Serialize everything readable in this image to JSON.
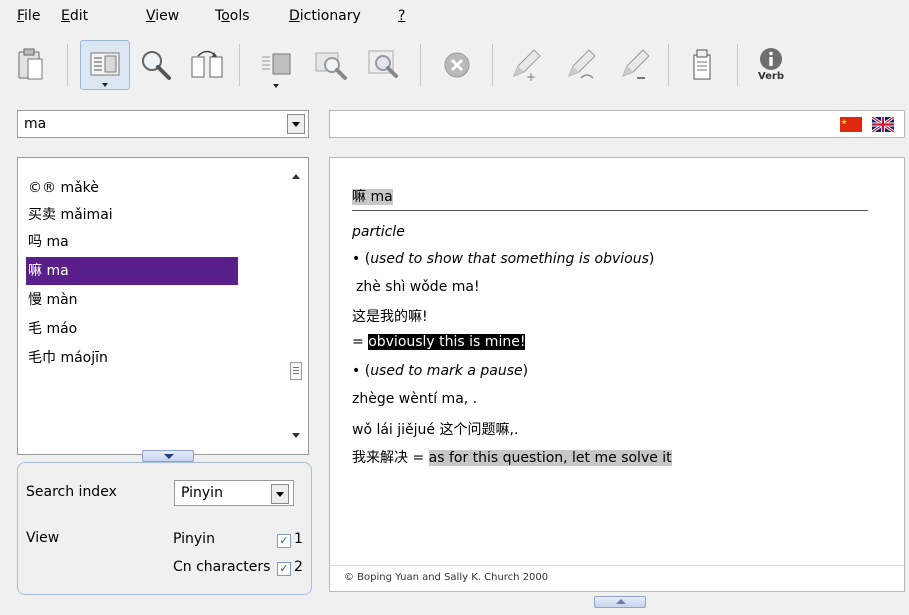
{
  "menu": {
    "file": {
      "accel": "F",
      "rest": "ile"
    },
    "edit": {
      "accel": "E",
      "rest": "dit"
    },
    "view": {
      "accel": "V",
      "rest": "iew"
    },
    "tools": {
      "pre": "T",
      "accel": "o",
      "rest": "ols"
    },
    "dictionary": {
      "accel": "D",
      "rest": "ictionary"
    },
    "help": {
      "accel": "?"
    }
  },
  "toolbar": {
    "icons": [
      "clipboard-icon",
      "dictionary-view-icon",
      "magnifier-icon",
      "flip-cards-icon",
      "list-view-icon",
      "search-next-icon",
      "search-page-icon",
      "cancel-icon",
      "pencil-add-icon",
      "pencil-edit-icon",
      "pencil-remove-icon",
      "document-icon",
      "verb-info-icon"
    ],
    "verb_label": "Verb"
  },
  "search": {
    "value": "ma"
  },
  "translation": {
    "value": "",
    "flags": [
      "china-flag-icon",
      "uk-flag-icon"
    ]
  },
  "results": {
    "items": [
      {
        "label": "©® mǎkè",
        "selected": false
      },
      {
        "label": "买卖 mǎimai",
        "selected": false
      },
      {
        "label": "吗 ma",
        "selected": false
      },
      {
        "label": "嘛 ma",
        "selected": true
      },
      {
        "label": "慢 màn",
        "selected": false
      },
      {
        "label": "毛 máo",
        "selected": false
      },
      {
        "label": "毛巾 máojīn",
        "selected": false
      }
    ]
  },
  "options": {
    "search_index_label": "Search index",
    "search_index_value": "Pinyin",
    "view_label": "View",
    "pinyin_label": "Pinyin",
    "pinyin_num": "1",
    "cn_label": "Cn characters",
    "cn_num": "2"
  },
  "entry": {
    "headword": "嘛 ma",
    "pos": "particle",
    "bullet": "•",
    "sense1_open": "(",
    "sense1": "used to show that something is obvious",
    "sense1_close": ")",
    "ex1_pinyin": "zhè shì wǒde ma!",
    "ex1_chinese": "这是我的嘛!",
    "eq": "=",
    "ex1_translation": "obviously this is mine!",
    "sense2_open": "(",
    "sense2": "used to mark a pause",
    "sense2_close": ")",
    "ex2_pinyin1": "zhège wèntí ma, .",
    "ex2_pinyin2": "wǒ lái jiějué",
    "ex2_chinese2": "这个问题嘛,.",
    "ex2_chinese3": "我来解决",
    "ex2_translation": "as for this question, let me solve it",
    "copyright": "© Boping Yuan and Sally K. Church 2000"
  },
  "colors": {
    "selection": "#5b1f8c",
    "highlight_gray": "#c7c7c7",
    "panel_border": "#a9bde0"
  }
}
